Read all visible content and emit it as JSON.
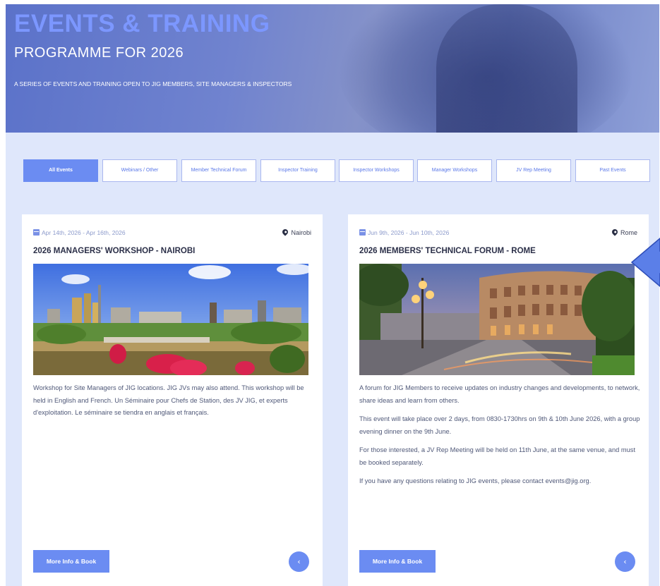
{
  "hero": {
    "title": "EVENTS & TRAINING",
    "subtitle": "PROGRAMME FOR 2026",
    "description": "A SERIES OF EVENTS AND TRAINING OPEN TO JIG MEMBERS, SITE MANAGERS & INSPECTORS"
  },
  "tabs": [
    {
      "label": "All Events",
      "active": true
    },
    {
      "label": "Webinars / Other",
      "active": false
    },
    {
      "label": "Member Technical Forum",
      "active": false
    },
    {
      "label": "Inspector Training",
      "active": false
    },
    {
      "label": "Inspector Workshops",
      "active": false
    },
    {
      "label": "Manager Workshops",
      "active": false
    },
    {
      "label": "JV Rep Meeting",
      "active": false
    },
    {
      "label": "Past Events",
      "active": false
    }
  ],
  "cards": [
    {
      "dates": "Apr 14th, 2026 - Apr 16th, 2026",
      "location": "Nairobi",
      "title": "2026 MANAGERS' WORKSHOP - NAIROBI",
      "paragraphs": [
        "Workshop for Site Managers of JIG locations. JIG JVs may also attend. This workshop will be held in English and French. Un Séminaire pour Chefs de Station, des JV JIG, et experts d'exploitation. Le séminaire se tiendra en anglais et français."
      ],
      "book_label": "More Info & Book",
      "share_icon": "share-icon"
    },
    {
      "dates": "Jun 9th, 2026 - Jun 10th, 2026",
      "location": "Rome",
      "title": "2026 MEMBERS' TECHNICAL FORUM - ROME",
      "paragraphs": [
        "A forum for JIG Members to receive updates on industry changes and developments, to network, share ideas and learn from others.",
        "This event will take place over 2 days, from 0830-1730hrs on 9th & 10th June 2026, with a group evening dinner on the 9th June.",
        "For those interested, a JV Rep Meeting will be held on 11th June, at the same venue, and must be booked separately.",
        "If you have any questions relating to JIG events, please contact events@jig.org."
      ],
      "book_label": "More Info & Book",
      "share_icon": "share-icon"
    }
  ],
  "colors": {
    "accent": "#6b8cf2",
    "background": "#dfe7fb",
    "title_text": "#2b2f48"
  }
}
